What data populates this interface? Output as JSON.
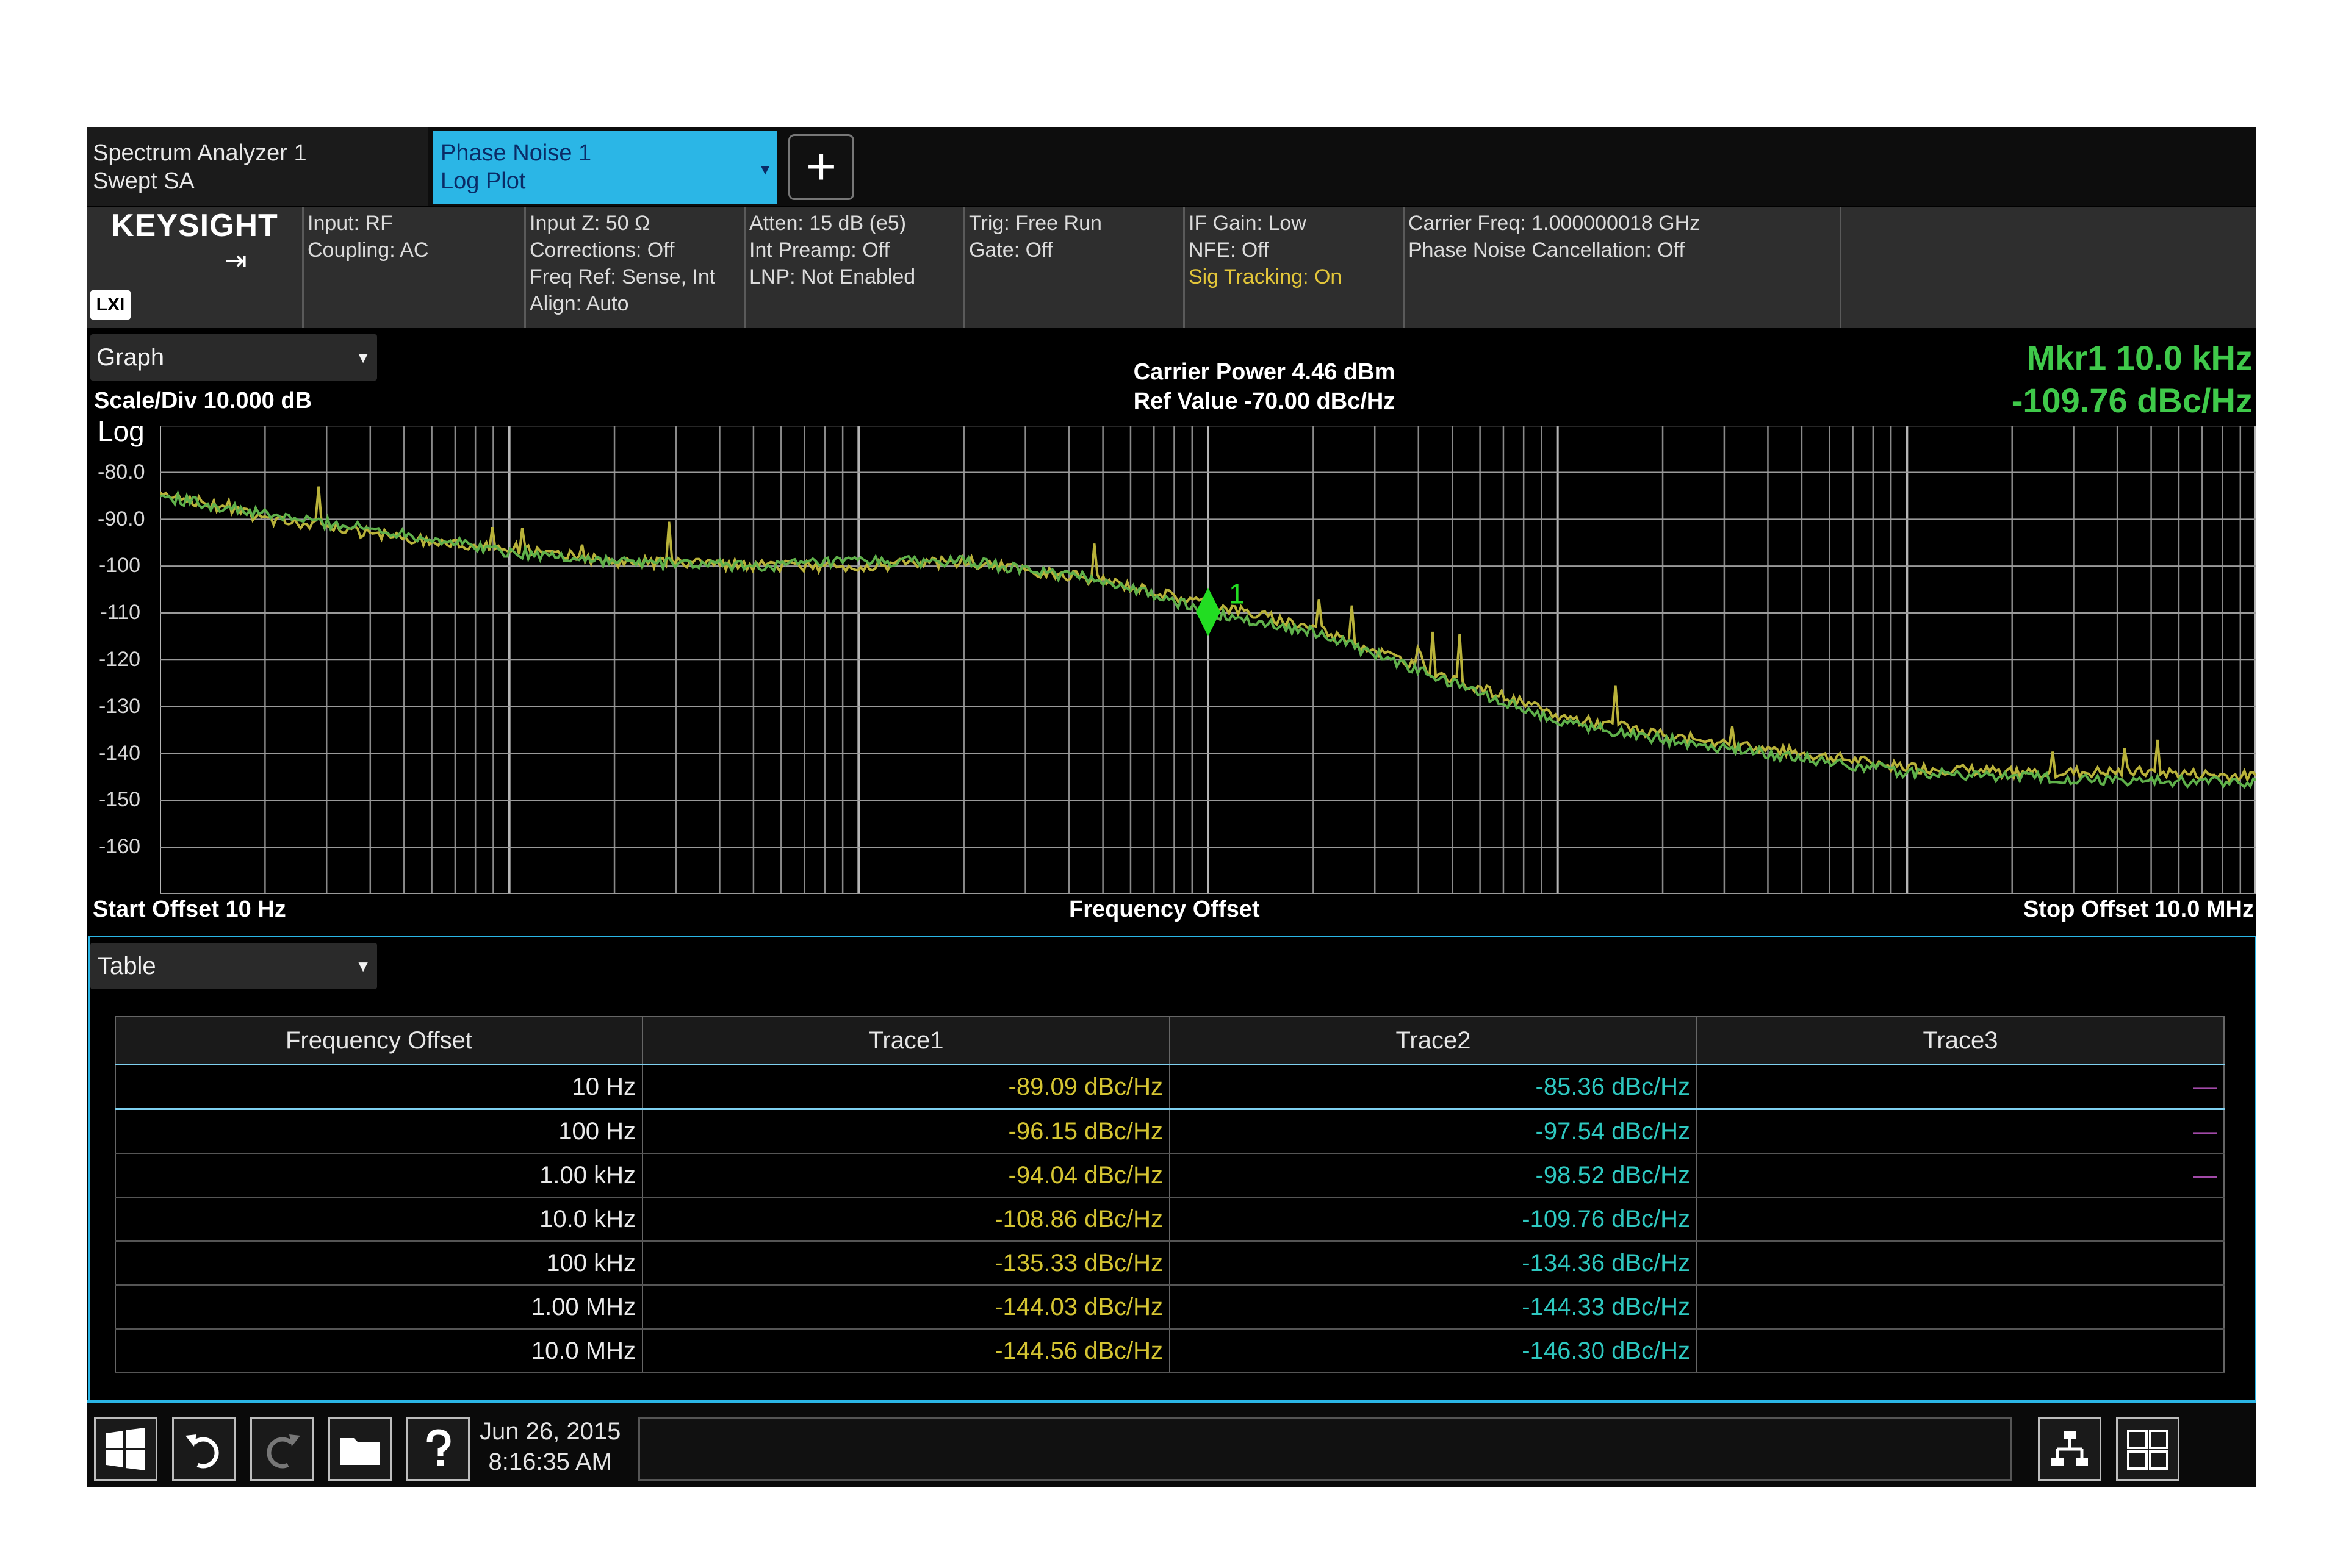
{
  "tabs": {
    "screen": {
      "line1": "Spectrum Analyzer 1",
      "line2": "Swept SA"
    },
    "mode": {
      "line1": "Phase Noise 1",
      "line2": "Log Plot"
    },
    "add_label": "+"
  },
  "brand": {
    "name": "KEYSIGHT",
    "lxi": "LXI"
  },
  "settings": [
    [
      "Input: RF",
      "Coupling: AC"
    ],
    [
      "Input Z: 50 Ω",
      "Corrections: Off",
      "Freq Ref: Sense, Int",
      "Align: Auto"
    ],
    [
      "Atten: 15 dB (e5)",
      "Int Preamp: Off",
      "LNP: Not Enabled"
    ],
    [
      "Trig: Free Run",
      "Gate: Off"
    ],
    [
      "IF Gain: Low",
      "NFE: Off",
      "Sig Tracking: On"
    ],
    [
      "Carrier Freq: 1.000000018 GHz",
      "Phase Noise Cancellation: Off"
    ]
  ],
  "graph": {
    "window_label": "Graph",
    "scale": "Scale/Div 10.000 dB",
    "log_label": "Log",
    "carrier_power": "Carrier Power 4.46 dBm",
    "ref_value": "Ref Value -70.00 dBc/Hz",
    "marker_line1": "Mkr1  10.0 kHz",
    "marker_line2": "-109.76 dBc/Hz",
    "marker_number": "1",
    "start_offset": "Start Offset 10 Hz",
    "x_axis": "Frequency Offset",
    "stop_offset": "Stop Offset 10.0 MHz",
    "y_ticks": [
      "-80.0",
      "-90.0",
      "-100",
      "-110",
      "-120",
      "-130",
      "-140",
      "-150",
      "-160"
    ]
  },
  "chart_data": {
    "type": "line",
    "x_scale": "log",
    "xlim": [
      10,
      10000000
    ],
    "ylim": [
      -170,
      -70
    ],
    "grid": true,
    "marker": {
      "x": 10000,
      "y": -109.76
    },
    "series": [
      {
        "color": "#b9b23a",
        "x": [
          10,
          20,
          50,
          100,
          200,
          500,
          1000,
          2000,
          5000,
          10000,
          20000,
          50000,
          100000,
          200000,
          500000,
          1000000,
          2000000,
          5000000,
          10000000
        ],
        "y": [
          -84,
          -90,
          -94,
          -96,
          -99,
          -100,
          -100,
          -99,
          -103,
          -108,
          -113,
          -124,
          -132,
          -136,
          -140,
          -143,
          -144,
          -144,
          -145
        ]
      },
      {
        "color": "#5fb04a",
        "x": [
          10,
          20,
          50,
          100,
          200,
          500,
          1000,
          2000,
          5000,
          10000,
          20000,
          50000,
          100000,
          200000,
          500000,
          1000000,
          2000000,
          5000000,
          10000000
        ],
        "y": [
          -85,
          -89,
          -93,
          -97,
          -99,
          -100,
          -99,
          -99,
          -103,
          -109.76,
          -114,
          -125,
          -133,
          -137,
          -141,
          -144,
          -145,
          -146,
          -146
        ]
      }
    ]
  },
  "table": {
    "window_label": "Table",
    "headers": [
      "Frequency Offset",
      "Trace1",
      "Trace2",
      "Trace3"
    ],
    "rows": [
      [
        "10 Hz",
        "-89.09 dBc/Hz",
        "-85.36 dBc/Hz",
        "—"
      ],
      [
        "100 Hz",
        "-96.15 dBc/Hz",
        "-97.54 dBc/Hz",
        "—"
      ],
      [
        "1.00 kHz",
        "-94.04 dBc/Hz",
        "-98.52 dBc/Hz",
        "—"
      ],
      [
        "10.0 kHz",
        "-108.86 dBc/Hz",
        "-109.76 dBc/Hz",
        ""
      ],
      [
        "100 kHz",
        "-135.33 dBc/Hz",
        "-134.36 dBc/Hz",
        ""
      ],
      [
        "1.00 MHz",
        "-144.03 dBc/Hz",
        "-144.33 dBc/Hz",
        ""
      ],
      [
        "10.0 MHz",
        "-144.56 dBc/Hz",
        "-146.30 dBc/Hz",
        ""
      ]
    ]
  },
  "taskbar": {
    "date": "Jun 26, 2015",
    "time": "8:16:35 AM"
  }
}
